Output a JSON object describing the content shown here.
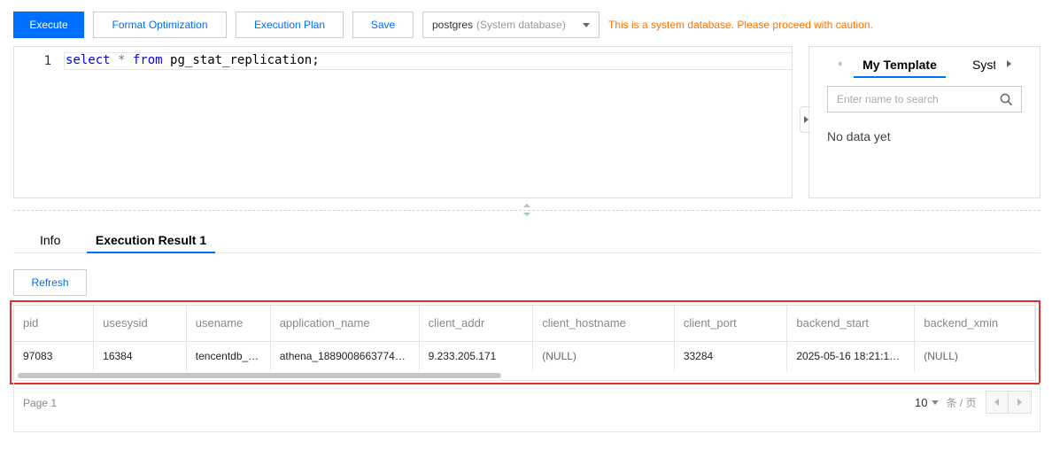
{
  "toolbar": {
    "execute_label": "Execute",
    "format_label": "Format Optimization",
    "plan_label": "Execution Plan",
    "save_label": "Save",
    "database": {
      "name": "postgres",
      "note": "(System database)"
    },
    "warning": "This is a system database. Please proceed with caution."
  },
  "editor": {
    "line_number": "1",
    "tokens": {
      "kw_select": "select",
      "op_star": "*",
      "kw_from": "from",
      "table": "pg_stat_replication;"
    }
  },
  "template_panel": {
    "tab_my": "My Template",
    "tab_system": "System",
    "search_placeholder": "Enter name to search",
    "empty_text": "No data yet"
  },
  "result_tabs": {
    "info": "Info",
    "result": "Execution Result 1"
  },
  "refresh_label": "Refresh",
  "table": {
    "columns": [
      "pid",
      "usesysid",
      "usename",
      "application_name",
      "client_addr",
      "client_hostname",
      "client_port",
      "backend_start",
      "backend_xmin"
    ],
    "rows": [
      [
        "97083",
        "16384",
        "tencentdb_…",
        "athena_1889008663774…",
        "9.233.205.171",
        "(NULL)",
        "33284",
        "2025-05-16 18:21:1…",
        "(NULL)"
      ]
    ]
  },
  "pagination": {
    "page_label": "Page 1",
    "page_size": "10",
    "page_size_unit": "条 / 页"
  },
  "colors": {
    "primary": "#006eff",
    "warning": "#ff7200",
    "highlight_border": "#e0302f"
  }
}
